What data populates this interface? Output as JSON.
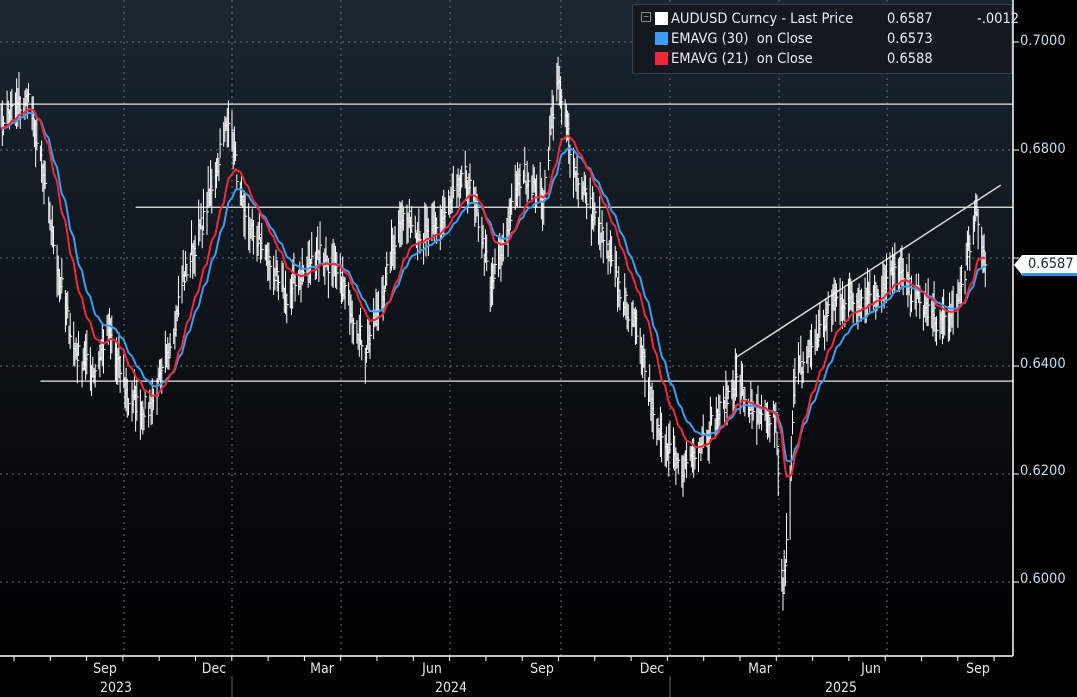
{
  "legend": {
    "series": [
      {
        "label": "AUDUSD Curncy - Last Price",
        "value": "0.6587",
        "change": "-.0012",
        "color": "#ffffff"
      },
      {
        "label": "EMAVG (30)  on Close",
        "value": "0.6573",
        "color": "#3d9bf0"
      },
      {
        "label": "EMAVG (21)  on Close",
        "value": "0.6588",
        "color": "#f0283c"
      }
    ]
  },
  "chart_data": {
    "type": "line",
    "title": "AUDUSD Curncy",
    "ylim": [
      0.588,
      0.7078
    ],
    "y_ticks": [
      "0.7000",
      "0.6800",
      "0.6400",
      "0.6200",
      "0.6000"
    ],
    "current_price_label": "0.6587",
    "x_month_labels": [
      "Sep",
      "Dec",
      "Mar",
      "Jun",
      "Sep",
      "Dec",
      "Mar",
      "Jun",
      "Sep"
    ],
    "x_year_labels": [
      "2023",
      "2024",
      "2025"
    ],
    "grid": true,
    "legend_position": "top-right",
    "series": [
      {
        "name": "AUDUSD Curncy - Last Price",
        "style": "high-low bars",
        "points": [
          [
            "2023-06-20",
            0.6856
          ],
          [
            "2023-07-14",
            0.6896
          ],
          [
            "2023-07-22",
            0.68
          ],
          [
            "2023-08-08",
            0.6578
          ],
          [
            "2023-08-21",
            0.643
          ],
          [
            "2023-09-07",
            0.639
          ],
          [
            "2023-09-19",
            0.6467
          ],
          [
            "2023-10-06",
            0.6337
          ],
          [
            "2023-10-23",
            0.632
          ],
          [
            "2023-11-05",
            0.6393
          ],
          [
            "2023-11-21",
            0.656
          ],
          [
            "2023-12-08",
            0.667
          ],
          [
            "2023-12-29",
            0.6865
          ],
          [
            "2024-01-11",
            0.667
          ],
          [
            "2024-01-28",
            0.6615
          ],
          [
            "2024-02-14",
            0.6522
          ],
          [
            "2024-03-15",
            0.6615
          ],
          [
            "2024-04-05",
            0.654
          ],
          [
            "2024-04-22",
            0.643
          ],
          [
            "2024-05-05",
            0.6522
          ],
          [
            "2024-05-22",
            0.668
          ],
          [
            "2024-06-16",
            0.6633
          ],
          [
            "2024-07-16",
            0.6754
          ],
          [
            "2024-07-28",
            0.6652
          ],
          [
            "2024-08-05",
            0.654
          ],
          [
            "2024-09-01",
            0.6763
          ],
          [
            "2024-09-18",
            0.6707
          ],
          [
            "2024-09-30",
            0.693
          ],
          [
            "2024-10-15",
            0.6763
          ],
          [
            "2024-11-05",
            0.6652
          ],
          [
            "2024-11-22",
            0.654
          ],
          [
            "2024-12-09",
            0.6448
          ],
          [
            "2024-12-26",
            0.6263
          ],
          [
            "2025-01-12",
            0.6207
          ],
          [
            "2025-01-29",
            0.6263
          ],
          [
            "2025-02-15",
            0.632
          ],
          [
            "2025-02-27",
            0.6374
          ],
          [
            "2025-03-16",
            0.63
          ],
          [
            "2025-04-02",
            0.63
          ],
          [
            "2025-04-08",
            0.5967
          ],
          [
            "2025-04-18",
            0.6374
          ],
          [
            "2025-05-05",
            0.6448
          ],
          [
            "2025-05-22",
            0.6522
          ],
          [
            "2025-06-08",
            0.6522
          ],
          [
            "2025-06-25",
            0.654
          ],
          [
            "2025-07-12",
            0.6578
          ],
          [
            "2025-07-29",
            0.6522
          ],
          [
            "2025-08-15",
            0.6485
          ],
          [
            "2025-08-28",
            0.6485
          ],
          [
            "2025-09-10",
            0.6596
          ],
          [
            "2025-09-18",
            0.6689
          ],
          [
            "2025-09-25",
            0.6587
          ]
        ]
      },
      {
        "name": "EMAVG (30) on Close",
        "period": 30,
        "last": 0.6573
      },
      {
        "name": "EMAVG (21) on Close",
        "period": 21,
        "last": 0.6588
      }
    ],
    "annotations": [
      {
        "type": "hline",
        "level": 0.6885,
        "from": "2023-06-20"
      },
      {
        "type": "hline",
        "level": 0.6694,
        "from": "2023-10-12"
      },
      {
        "type": "hline",
        "level": 0.6372,
        "from": "2023-07-24"
      },
      {
        "type": "trendline",
        "from": [
          "2025-02-27",
          0.6415
        ],
        "to": [
          "2025-10-08",
          0.6735
        ]
      }
    ]
  }
}
